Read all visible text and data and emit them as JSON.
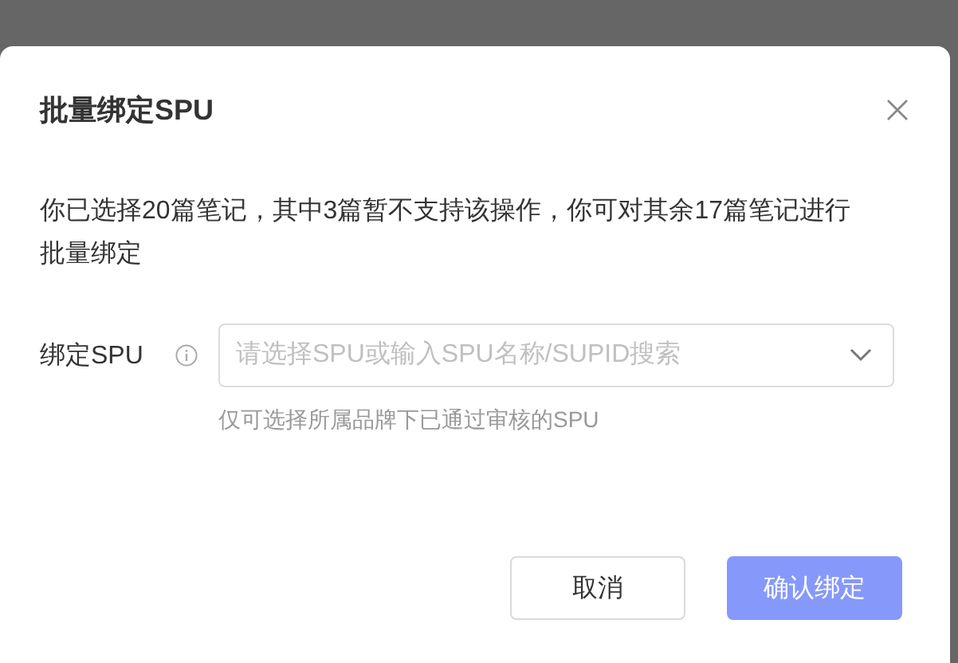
{
  "dialog": {
    "title": "批量绑定SPU",
    "message": "你已选择20篇笔记，其中3篇暂不支持该操作，你可对其余17篇笔记进行批量绑定",
    "field": {
      "label": "绑定SPU",
      "placeholder": "请选择SPU或输入SPU名称/SUPID搜索",
      "hint": "仅可选择所属品牌下已通过审核的SPU"
    },
    "buttons": [
      {
        "label": "取消",
        "kind": "secondary",
        "disabled": false
      },
      {
        "label": "确认绑定",
        "kind": "primary",
        "disabled": true
      }
    ]
  }
}
